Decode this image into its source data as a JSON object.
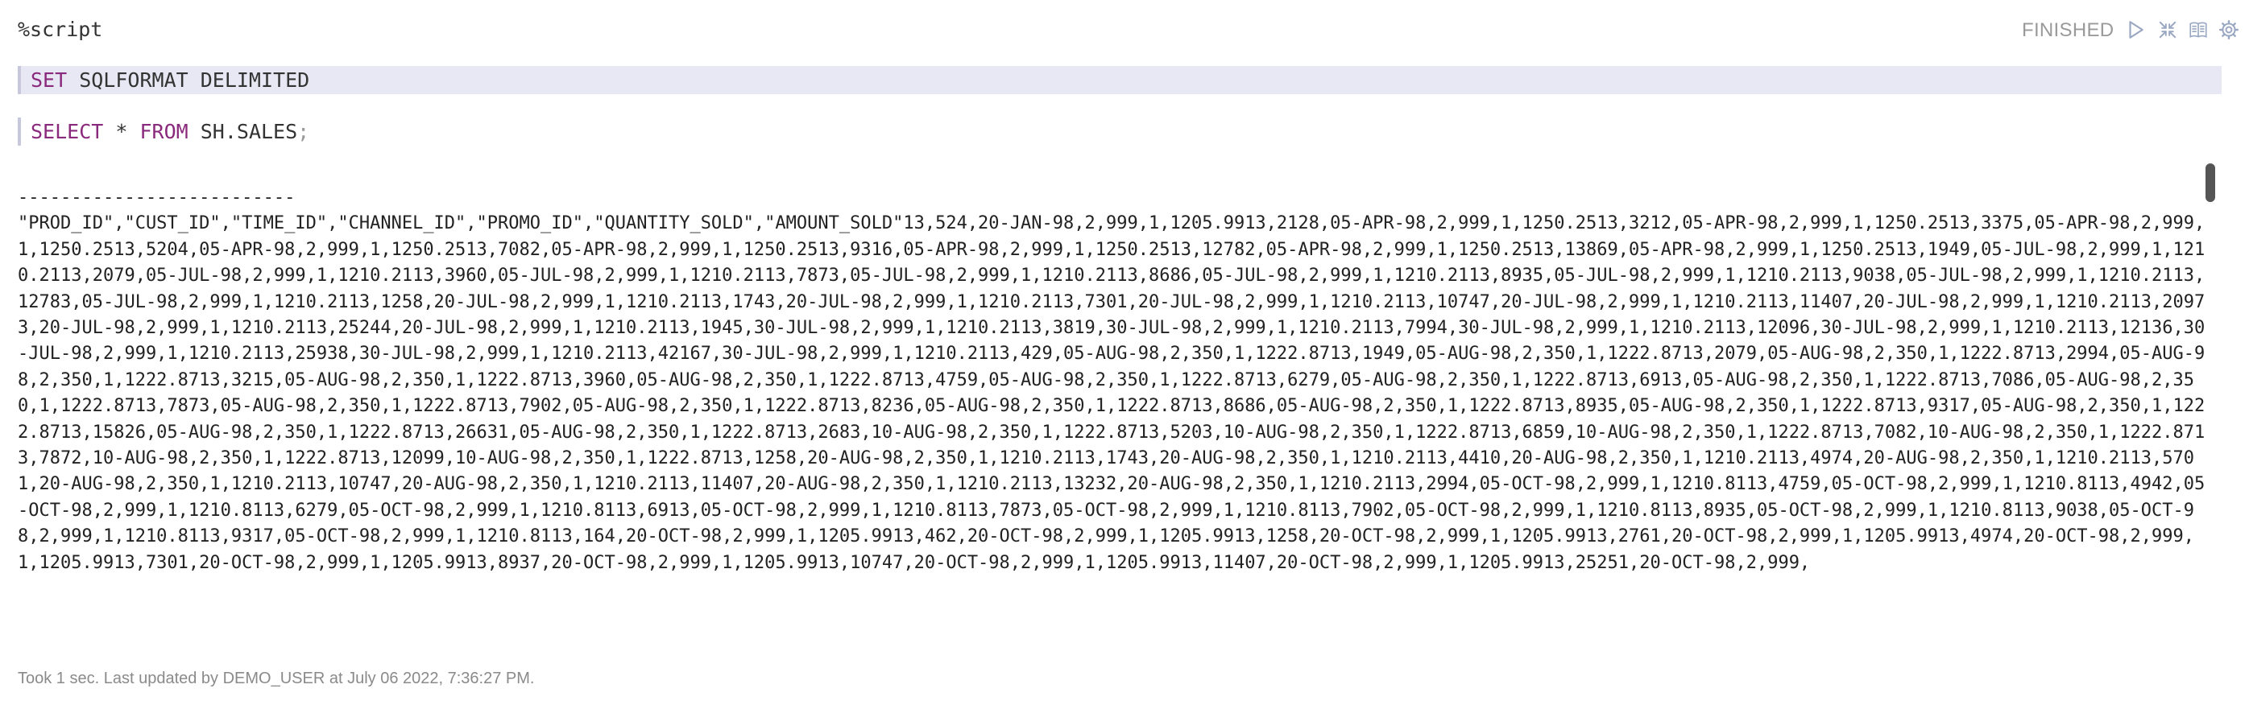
{
  "editor": {
    "lines": [
      {
        "text": "%script"
      },
      {
        "keyword": "SET",
        "rest": " SQLFORMAT DELIMITED"
      },
      {
        "kw1": "SELECT",
        "mid": " * ",
        "kw2": "FROM",
        "rest": " SH.SALES",
        "punct": ";"
      }
    ]
  },
  "header": {
    "status": "FINISHED",
    "controls": [
      "run-icon",
      "collapse-icon",
      "book-icon",
      "gear-icon"
    ]
  },
  "output": {
    "separator": "--------------------------",
    "text": "\"PROD_ID\",\"CUST_ID\",\"TIME_ID\",\"CHANNEL_ID\",\"PROMO_ID\",\"QUANTITY_SOLD\",\"AMOUNT_SOLD\"13,524,20-JAN-98,2,999,1,1205.9913,2128,05-APR-98,2,999,1,1250.2513,3212,05-APR-98,2,999,1,1250.2513,3375,05-APR-98,2,999,1,1250.2513,5204,05-APR-98,2,999,1,1250.2513,7082,05-APR-98,2,999,1,1250.2513,9316,05-APR-98,2,999,1,1250.2513,12782,05-APR-98,2,999,1,1250.2513,13869,05-APR-98,2,999,1,1250.2513,1949,05-JUL-98,2,999,1,1210.2113,2079,05-JUL-98,2,999,1,1210.2113,3960,05-JUL-98,2,999,1,1210.2113,7873,05-JUL-98,2,999,1,1210.2113,8686,05-JUL-98,2,999,1,1210.2113,8935,05-JUL-98,2,999,1,1210.2113,9038,05-JUL-98,2,999,1,1210.2113,12783,05-JUL-98,2,999,1,1210.2113,1258,20-JUL-98,2,999,1,1210.2113,1743,20-JUL-98,2,999,1,1210.2113,7301,20-JUL-98,2,999,1,1210.2113,10747,20-JUL-98,2,999,1,1210.2113,11407,20-JUL-98,2,999,1,1210.2113,20973,20-JUL-98,2,999,1,1210.2113,25244,20-JUL-98,2,999,1,1210.2113,1945,30-JUL-98,2,999,1,1210.2113,3819,30-JUL-98,2,999,1,1210.2113,7994,30-JUL-98,2,999,1,1210.2113,12096,30-JUL-98,2,999,1,1210.2113,12136,30-JUL-98,2,999,1,1210.2113,25938,30-JUL-98,2,999,1,1210.2113,42167,30-JUL-98,2,999,1,1210.2113,429,05-AUG-98,2,350,1,1222.8713,1949,05-AUG-98,2,350,1,1222.8713,2079,05-AUG-98,2,350,1,1222.8713,2994,05-AUG-98,2,350,1,1222.8713,3215,05-AUG-98,2,350,1,1222.8713,3960,05-AUG-98,2,350,1,1222.8713,4759,05-AUG-98,2,350,1,1222.8713,6279,05-AUG-98,2,350,1,1222.8713,6913,05-AUG-98,2,350,1,1222.8713,7086,05-AUG-98,2,350,1,1222.8713,7873,05-AUG-98,2,350,1,1222.8713,7902,05-AUG-98,2,350,1,1222.8713,8236,05-AUG-98,2,350,1,1222.8713,8686,05-AUG-98,2,350,1,1222.8713,8935,05-AUG-98,2,350,1,1222.8713,9317,05-AUG-98,2,350,1,1222.8713,15826,05-AUG-98,2,350,1,1222.8713,26631,05-AUG-98,2,350,1,1222.8713,2683,10-AUG-98,2,350,1,1222.8713,5203,10-AUG-98,2,350,1,1222.8713,6859,10-AUG-98,2,350,1,1222.8713,7082,10-AUG-98,2,350,1,1222.8713,7872,10-AUG-98,2,350,1,1222.8713,12099,10-AUG-98,2,350,1,1222.8713,1258,20-AUG-98,2,350,1,1210.2113,1743,20-AUG-98,2,350,1,1210.2113,4410,20-AUG-98,2,350,1,1210.2113,4974,20-AUG-98,2,350,1,1210.2113,5701,20-AUG-98,2,350,1,1210.2113,10747,20-AUG-98,2,350,1,1210.2113,11407,20-AUG-98,2,350,1,1210.2113,13232,20-AUG-98,2,350,1,1210.2113,2994,05-OCT-98,2,999,1,1210.8113,4759,05-OCT-98,2,999,1,1210.8113,4942,05-OCT-98,2,999,1,1210.8113,6279,05-OCT-98,2,999,1,1210.8113,6913,05-OCT-98,2,999,1,1210.8113,7873,05-OCT-98,2,999,1,1210.8113,7902,05-OCT-98,2,999,1,1210.8113,8935,05-OCT-98,2,999,1,1210.8113,9038,05-OCT-98,2,999,1,1210.8113,9317,05-OCT-98,2,999,1,1210.8113,164,20-OCT-98,2,999,1,1205.9913,462,20-OCT-98,2,999,1,1205.9913,1258,20-OCT-98,2,999,1,1205.9913,2761,20-OCT-98,2,999,1,1205.9913,4974,20-OCT-98,2,999,1,1205.9913,7301,20-OCT-98,2,999,1,1205.9913,8937,20-OCT-98,2,999,1,1205.9913,10747,20-OCT-98,2,999,1,1205.9913,11407,20-OCT-98,2,999,1,1205.9913,25251,20-OCT-98,2,999,"
  },
  "footer": {
    "text": "Took 1 sec. Last updated by DEMO_USER at July 06 2022, 7:36:27 PM."
  }
}
